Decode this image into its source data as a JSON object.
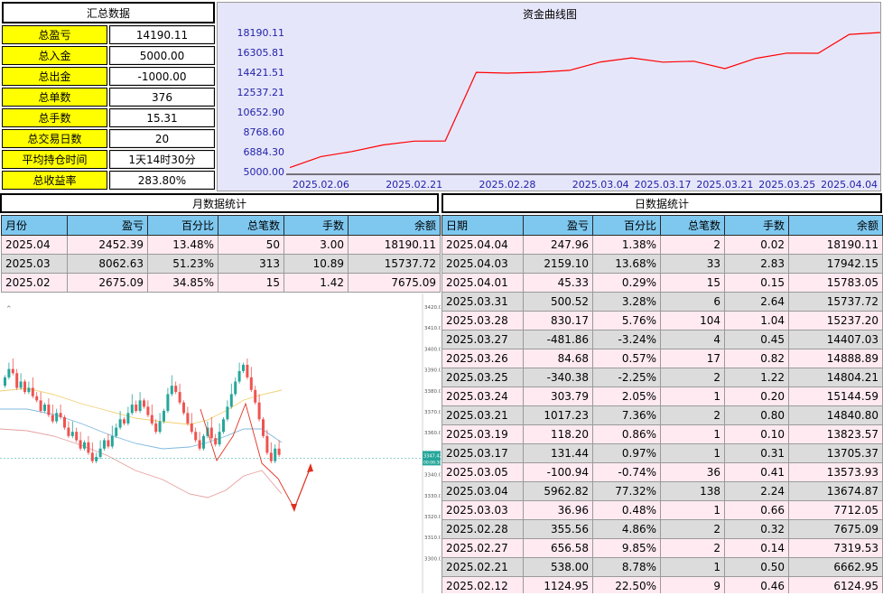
{
  "summary": {
    "title": "汇总数据",
    "rows": [
      {
        "label": "总盈亏",
        "value": "14190.11"
      },
      {
        "label": "总入金",
        "value": "5000.00"
      },
      {
        "label": "总出金",
        "value": "-1000.00"
      },
      {
        "label": "总单数",
        "value": "376"
      },
      {
        "label": "总手数",
        "value": "15.31"
      },
      {
        "label": "总交易日数",
        "value": "20"
      },
      {
        "label": "平均持仓时间",
        "value": "1天14时30分"
      },
      {
        "label": "总收益率",
        "value": "283.80%"
      }
    ]
  },
  "chart_data": {
    "type": "line",
    "title": "资金曲线图",
    "y_ticks": [
      "18190.11",
      "16305.81",
      "14421.51",
      "12537.21",
      "10652.90",
      "8768.60",
      "6884.30",
      "5000.00"
    ],
    "ylim": [
      5000.0,
      18190.11
    ],
    "x_ticks": [
      "2025.02.06",
      "2025.02.21",
      "2025.02.28",
      "2025.03.04",
      "2025.03.17",
      "2025.03.21",
      "2025.03.25",
      "2025.04.04"
    ],
    "series": [
      {
        "color": "#ff0000",
        "values": [
          5380,
          6420,
          6900,
          7530,
          7890,
          7900,
          14410,
          14340,
          14420,
          14600,
          15400,
          15780,
          15380,
          15470,
          14760,
          15740,
          16240,
          16220,
          18010,
          18190.11
        ]
      }
    ],
    "grid": false
  },
  "monthly": {
    "title": "月数据统计",
    "headers": [
      "月份",
      "盈亏",
      "百分比",
      "总笔数",
      "手数",
      "余额"
    ],
    "rows": [
      [
        "2025.04",
        "2452.39",
        "13.48%",
        "50",
        "3.00",
        "18190.11"
      ],
      [
        "2025.03",
        "8062.63",
        "51.23%",
        "313",
        "10.89",
        "15737.72"
      ],
      [
        "2025.02",
        "2675.09",
        "34.85%",
        "15",
        "1.42",
        "7675.09"
      ]
    ]
  },
  "daily": {
    "title": "日数据统计",
    "headers": [
      "日期",
      "盈亏",
      "百分比",
      "总笔数",
      "手数",
      "余额"
    ],
    "rows": [
      [
        "2025.04.04",
        "247.96",
        "1.38%",
        "2",
        "0.02",
        "18190.11"
      ],
      [
        "2025.04.03",
        "2159.10",
        "13.68%",
        "33",
        "2.83",
        "17942.15"
      ],
      [
        "2025.04.01",
        "45.33",
        "0.29%",
        "15",
        "0.15",
        "15783.05"
      ],
      [
        "2025.03.31",
        "500.52",
        "3.28%",
        "6",
        "2.64",
        "15737.72"
      ],
      [
        "2025.03.28",
        "830.17",
        "5.76%",
        "104",
        "1.04",
        "15237.20"
      ],
      [
        "2025.03.27",
        "-481.86",
        "-3.24%",
        "4",
        "0.45",
        "14407.03"
      ],
      [
        "2025.03.26",
        "84.68",
        "0.57%",
        "17",
        "0.82",
        "14888.89"
      ],
      [
        "2025.03.25",
        "-340.38",
        "-2.25%",
        "2",
        "1.22",
        "14804.21"
      ],
      [
        "2025.03.24",
        "303.79",
        "2.05%",
        "1",
        "0.20",
        "15144.59"
      ],
      [
        "2025.03.21",
        "1017.23",
        "7.36%",
        "2",
        "0.80",
        "14840.80"
      ],
      [
        "2025.03.19",
        "118.20",
        "0.86%",
        "1",
        "0.10",
        "13823.57"
      ],
      [
        "2025.03.17",
        "131.44",
        "0.97%",
        "1",
        "0.31",
        "13705.37"
      ],
      [
        "2025.03.05",
        "-100.94",
        "-0.74%",
        "36",
        "0.41",
        "13573.93"
      ],
      [
        "2025.03.04",
        "5962.82",
        "77.32%",
        "138",
        "2.24",
        "13674.87"
      ],
      [
        "2025.03.03",
        "36.96",
        "0.48%",
        "1",
        "0.66",
        "7712.05"
      ],
      [
        "2025.02.28",
        "355.56",
        "4.86%",
        "2",
        "0.32",
        "7675.09"
      ],
      [
        "2025.02.27",
        "656.58",
        "9.85%",
        "2",
        "0.14",
        "7319.53"
      ],
      [
        "2025.02.21",
        "538.00",
        "8.78%",
        "1",
        "0.50",
        "6662.95"
      ],
      [
        "2025.02.12",
        "1124.95",
        "22.50%",
        "9",
        "0.46",
        "6124.95"
      ]
    ]
  },
  "kline": {
    "price_labels": [
      "3420.00",
      "3410.00",
      "3400.00",
      "3390.00",
      "3380.00",
      "3370.00",
      "3360.00",
      "3350.00",
      "3340.00",
      "3330.00",
      "3320.00",
      "3310.00",
      "3300.00"
    ],
    "current_price": "3347.42",
    "current_sub": "00:06:30",
    "up_color": "#26a69a",
    "down_color": "#ef5350",
    "arrow_color": "#e03020"
  }
}
